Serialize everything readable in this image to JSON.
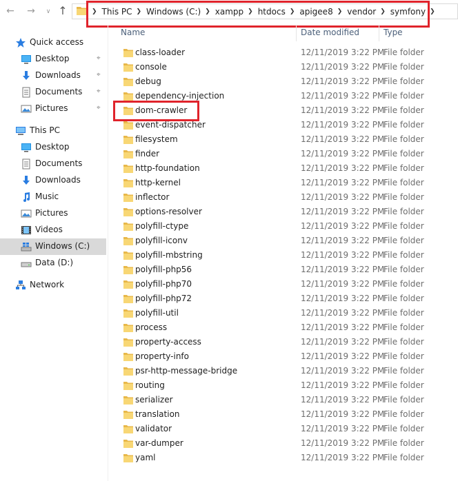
{
  "nav_buttons": {
    "back_icon": "arrow-left-icon",
    "forward_icon": "arrow-right-icon",
    "recent_icon": "chevron-down-icon",
    "up_icon": "arrow-up-icon"
  },
  "address_bar": {
    "crumbs": [
      "This PC",
      "Windows (C:)",
      "xampp",
      "htdocs",
      "apigee8",
      "vendor",
      "symfony"
    ]
  },
  "nav_pane": {
    "quick_access": {
      "label": "Quick access",
      "items": [
        {
          "label": "Desktop",
          "icon": "desktop-icon",
          "pinned": true
        },
        {
          "label": "Downloads",
          "icon": "downloads-icon",
          "pinned": true
        },
        {
          "label": "Documents",
          "icon": "documents-icon",
          "pinned": true
        },
        {
          "label": "Pictures",
          "icon": "pictures-icon",
          "pinned": true
        }
      ]
    },
    "this_pc": {
      "label": "This PC",
      "items": [
        {
          "label": "Desktop",
          "icon": "desktop-icon"
        },
        {
          "label": "Documents",
          "icon": "documents-icon"
        },
        {
          "label": "Downloads",
          "icon": "downloads-icon"
        },
        {
          "label": "Music",
          "icon": "music-icon"
        },
        {
          "label": "Pictures",
          "icon": "pictures-icon"
        },
        {
          "label": "Videos",
          "icon": "videos-icon"
        },
        {
          "label": "Windows (C:)",
          "icon": "windows-drive-icon",
          "selected": true
        },
        {
          "label": "Data (D:)",
          "icon": "drive-icon"
        }
      ]
    },
    "network": {
      "label": "Network",
      "icon": "network-icon"
    }
  },
  "columns": {
    "name": "Name",
    "date_modified": "Date modified",
    "type": "Type"
  },
  "files": [
    {
      "name": "class-loader",
      "date": "12/11/2019 3:22 PM",
      "type": "File folder"
    },
    {
      "name": "console",
      "date": "12/11/2019 3:22 PM",
      "type": "File folder"
    },
    {
      "name": "debug",
      "date": "12/11/2019 3:22 PM",
      "type": "File folder"
    },
    {
      "name": "dependency-injection",
      "date": "12/11/2019 3:22 PM",
      "type": "File folder"
    },
    {
      "name": "dom-crawler",
      "date": "12/11/2019 3:22 PM",
      "type": "File folder",
      "highlighted": true
    },
    {
      "name": "event-dispatcher",
      "date": "12/11/2019 3:22 PM",
      "type": "File folder"
    },
    {
      "name": "filesystem",
      "date": "12/11/2019 3:22 PM",
      "type": "File folder"
    },
    {
      "name": "finder",
      "date": "12/11/2019 3:22 PM",
      "type": "File folder"
    },
    {
      "name": "http-foundation",
      "date": "12/11/2019 3:22 PM",
      "type": "File folder"
    },
    {
      "name": "http-kernel",
      "date": "12/11/2019 3:22 PM",
      "type": "File folder"
    },
    {
      "name": "inflector",
      "date": "12/11/2019 3:22 PM",
      "type": "File folder"
    },
    {
      "name": "options-resolver",
      "date": "12/11/2019 3:22 PM",
      "type": "File folder"
    },
    {
      "name": "polyfill-ctype",
      "date": "12/11/2019 3:22 PM",
      "type": "File folder"
    },
    {
      "name": "polyfill-iconv",
      "date": "12/11/2019 3:22 PM",
      "type": "File folder"
    },
    {
      "name": "polyfill-mbstring",
      "date": "12/11/2019 3:22 PM",
      "type": "File folder"
    },
    {
      "name": "polyfill-php56",
      "date": "12/11/2019 3:22 PM",
      "type": "File folder"
    },
    {
      "name": "polyfill-php70",
      "date": "12/11/2019 3:22 PM",
      "type": "File folder"
    },
    {
      "name": "polyfill-php72",
      "date": "12/11/2019 3:22 PM",
      "type": "File folder"
    },
    {
      "name": "polyfill-util",
      "date": "12/11/2019 3:22 PM",
      "type": "File folder"
    },
    {
      "name": "process",
      "date": "12/11/2019 3:22 PM",
      "type": "File folder"
    },
    {
      "name": "property-access",
      "date": "12/11/2019 3:22 PM",
      "type": "File folder"
    },
    {
      "name": "property-info",
      "date": "12/11/2019 3:22 PM",
      "type": "File folder"
    },
    {
      "name": "psr-http-message-bridge",
      "date": "12/11/2019 3:22 PM",
      "type": "File folder"
    },
    {
      "name": "routing",
      "date": "12/11/2019 3:22 PM",
      "type": "File folder"
    },
    {
      "name": "serializer",
      "date": "12/11/2019 3:22 PM",
      "type": "File folder"
    },
    {
      "name": "translation",
      "date": "12/11/2019 3:22 PM",
      "type": "File folder"
    },
    {
      "name": "validator",
      "date": "12/11/2019 3:22 PM",
      "type": "File folder"
    },
    {
      "name": "var-dumper",
      "date": "12/11/2019 3:22 PM",
      "type": "File folder"
    },
    {
      "name": "yaml",
      "date": "12/11/2019 3:22 PM",
      "type": "File folder"
    }
  ],
  "colors": {
    "annotation_red": "#e0232b",
    "folder_yellow": "#f8d775",
    "header_text": "#4c607a",
    "selected_bg": "#d9d9d9"
  }
}
